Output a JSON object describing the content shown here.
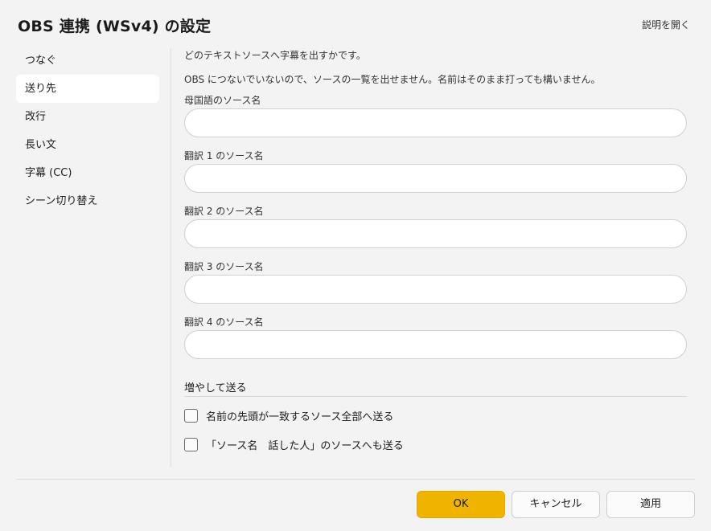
{
  "window": {
    "title": "OBS 連携 (WSv4) の設定",
    "help_link": "説明を開く"
  },
  "sidebar": {
    "items": [
      {
        "label": "つなぐ",
        "selected": false
      },
      {
        "label": "送り先",
        "selected": true
      },
      {
        "label": "改行",
        "selected": false
      },
      {
        "label": "長い文",
        "selected": false
      },
      {
        "label": "字幕 (CC)",
        "selected": false
      },
      {
        "label": "シーン切り替え",
        "selected": false
      }
    ]
  },
  "main": {
    "description_1": "どのテキストソースへ字幕を出すかです。",
    "description_2": "OBS につないでいないので、ソースの一覧を出せません。名前はそのまま打っても構いません。",
    "fields": [
      {
        "label": "母国語のソース名",
        "value": ""
      },
      {
        "label": "翻訳 1 のソース名",
        "value": ""
      },
      {
        "label": "翻訳 2 のソース名",
        "value": ""
      },
      {
        "label": "翻訳 3 のソース名",
        "value": ""
      },
      {
        "label": "翻訳 4 のソース名",
        "value": ""
      }
    ],
    "section_title": "増やして送る",
    "checkboxes": [
      {
        "label": "名前の先頭が一致するソース全部へ送る",
        "checked": false
      },
      {
        "label": "「ソース名　話した人」のソースへも送る",
        "checked": false
      }
    ]
  },
  "footer": {
    "ok_label": "OK",
    "cancel_label": "キャンセル",
    "apply_label": "適用",
    "accent_color": "#f0b400"
  }
}
